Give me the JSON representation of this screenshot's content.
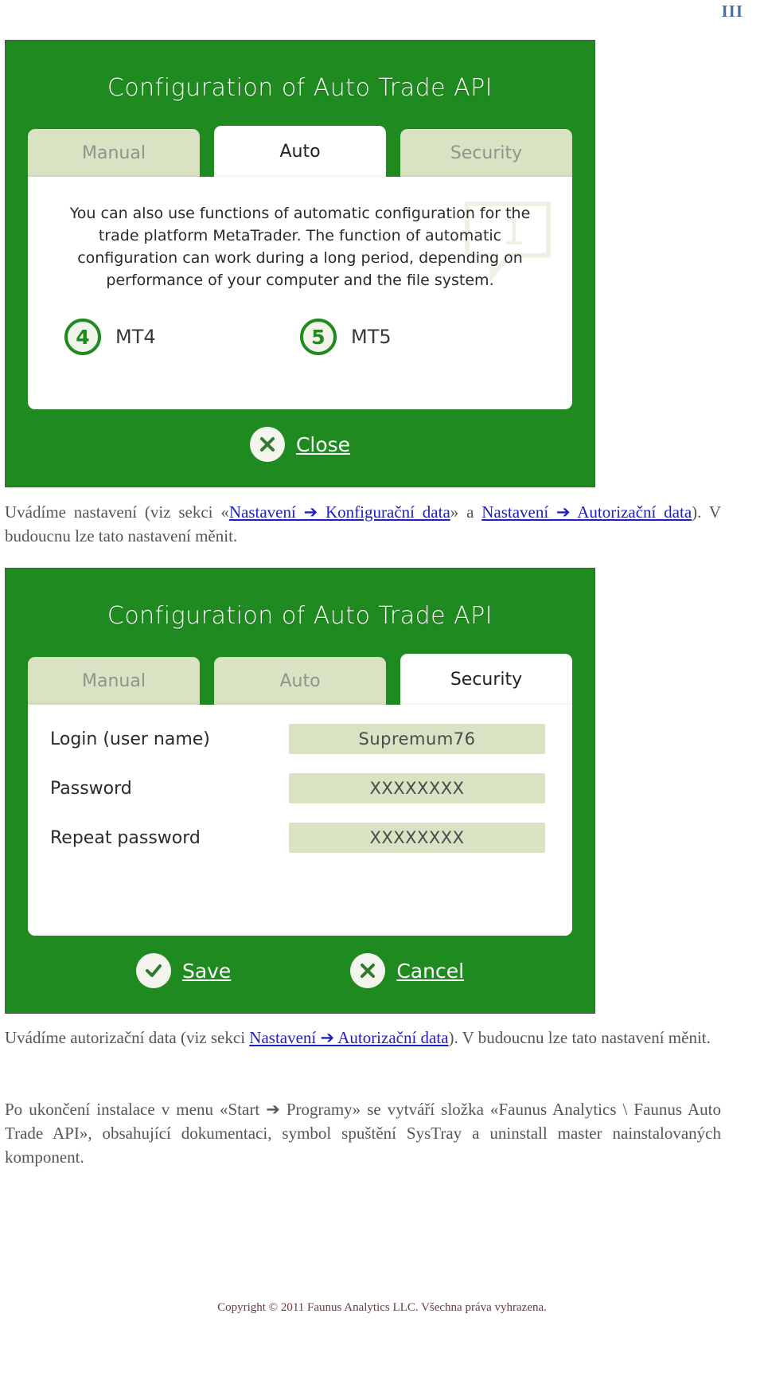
{
  "page": {
    "number": "III",
    "copyright": "Copyright © 2011 Faunus Analytics LLC. Všechna práva vyhrazena."
  },
  "dialog_auto": {
    "title": "Configuration of Auto Trade API",
    "tabs": [
      {
        "label": "Manual",
        "active": false
      },
      {
        "label": "Auto",
        "active": true
      },
      {
        "label": "Security",
        "active": false
      }
    ],
    "body_text": "You can also use functions of automatic configuration for the trade platform MetaTrader. The function of automatic configuration can work during a long period, depending on performance of your computer and the file system.",
    "options": [
      {
        "badge": "4",
        "label": "MT4"
      },
      {
        "badge": "5",
        "label": "MT5"
      }
    ],
    "actions": [
      {
        "label": "Close",
        "icon": "close-x-icon"
      }
    ]
  },
  "dialog_security": {
    "title": "Configuration of Auto Trade API",
    "tabs": [
      {
        "label": "Manual",
        "active": false
      },
      {
        "label": "Auto",
        "active": false
      },
      {
        "label": "Security",
        "active": true
      }
    ],
    "fields": [
      {
        "label": "Login (user name)",
        "value": "Supremum76"
      },
      {
        "label": "Password",
        "value": "XXXXXXXX"
      },
      {
        "label": "Repeat password",
        "value": "XXXXXXXX"
      }
    ],
    "actions": [
      {
        "label": "Save",
        "icon": "check-icon"
      },
      {
        "label": "Cancel",
        "icon": "close-x-icon"
      }
    ]
  },
  "prose": {
    "p1_a": "Uvádíme nastavení (viz sekci «",
    "p1_link1": "Nastavení ➔ Konfigurační data",
    "p1_b": "» a ",
    "p1_link2": "Nastavení ➔ Autorizační data",
    "p1_c": "). V budoucnu lze tato nastavení měnit.",
    "p2_a": "Uvádíme autorizační data (viz sekci ",
    "p2_link1": "Nastavení ➔ Autorizační data",
    "p2_b": "). V budoucnu lze tato nastavení měnit.",
    "p3": "Po ukončení instalace v menu «Start ➔ Programy» se vytváří složka «Faunus Analytics \\ Faunus Auto Trade API», obsahující dokumentaci, symbol spuštění SysTray a uninstall master  nainstalovaných komponent."
  },
  "colors": {
    "dialog_green": "#1f8a1f",
    "tab_inactive": "#d9e3c3",
    "link_blue": "#2020c0",
    "page_num_blue": "#4a6fa5"
  }
}
